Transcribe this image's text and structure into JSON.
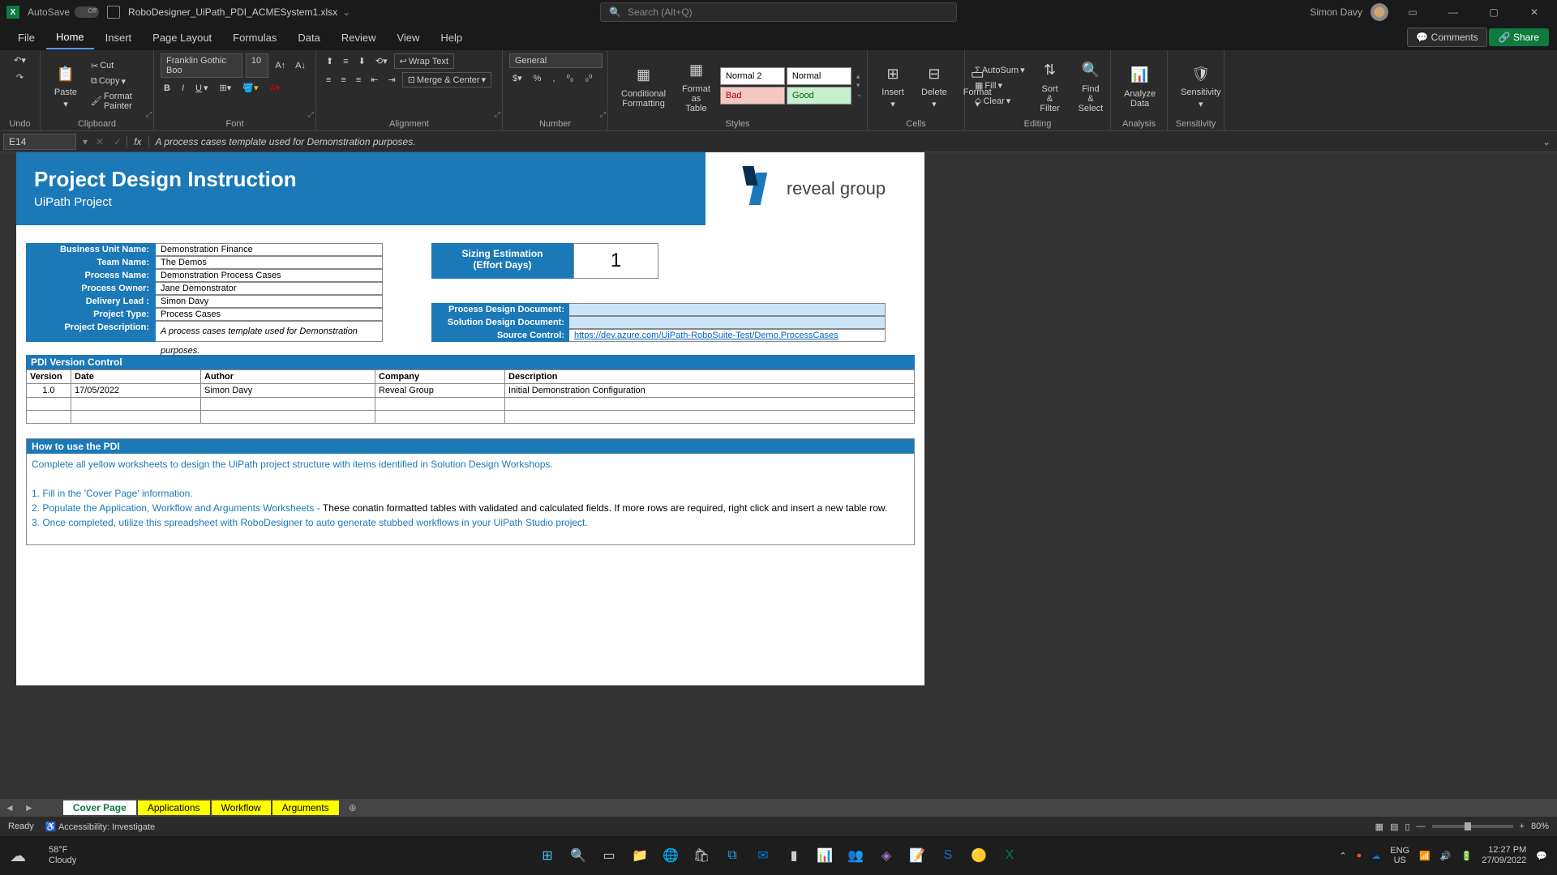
{
  "titlebar": {
    "autosave": "AutoSave",
    "filename": "RoboDesigner_UiPath_PDI_ACMESystem1.xlsx",
    "search_placeholder": "Search (Alt+Q)",
    "user": "Simon Davy"
  },
  "menu": {
    "file": "File",
    "home": "Home",
    "insert": "Insert",
    "page_layout": "Page Layout",
    "formulas": "Formulas",
    "data": "Data",
    "review": "Review",
    "view": "View",
    "help": "Help",
    "comments": "Comments",
    "share": "Share"
  },
  "ribbon": {
    "undo": "Undo",
    "paste": "Paste",
    "cut": "Cut",
    "copy": "Copy",
    "format_painter": "Format Painter",
    "clipboard": "Clipboard",
    "font_name": "Franklin Gothic Boo",
    "font_size": "10",
    "font": "Font",
    "wrap_text": "Wrap Text",
    "merge_center": "Merge & Center",
    "alignment": "Alignment",
    "number_format": "General",
    "number": "Number",
    "cond_fmt": "Conditional\nFormatting",
    "fmt_table": "Format as\nTable",
    "style_normal2": "Normal 2",
    "style_normal": "Normal",
    "style_bad": "Bad",
    "style_good": "Good",
    "styles": "Styles",
    "insert_btn": "Insert",
    "delete_btn": "Delete",
    "format_btn": "Format",
    "cells": "Cells",
    "autosum": "AutoSum",
    "fill": "Fill",
    "clear": "Clear",
    "sort_filter": "Sort &\nFilter",
    "find_select": "Find &\nSelect",
    "editing": "Editing",
    "analyze": "Analyze\nData",
    "analysis": "Analysis",
    "sensitivity": "Sensitivity",
    "sensitivity_g": "Sensitivity"
  },
  "fbar": {
    "cell": "E14",
    "formula": "A process cases template used for Demonstration purposes."
  },
  "doc": {
    "title": "Project Design Instruction",
    "subtitle": "UiPath Project",
    "logo_text": "reveal group",
    "labels": {
      "bu": "Business Unit Name:",
      "team": "Team Name:",
      "process": "Process Name:",
      "owner": "Process Owner:",
      "lead": "Delivery Lead :",
      "ptype": "Project Type:",
      "pdesc": "Project Description:"
    },
    "values": {
      "bu": "Demonstration Finance",
      "team": "The Demos",
      "process": "Demonstration Process Cases",
      "owner": "Jane Demonstrator",
      "lead": "Simon Davy",
      "ptype": "Process Cases",
      "pdesc": "A process cases template used for Demonstration purposes."
    },
    "size_label": "Sizing Estimation\n(Effort Days)",
    "size_value": "1",
    "doc_labels": {
      "pdd": "Process Design Document:",
      "sdd": "Solution Design Document:",
      "src": "Source Control:"
    },
    "doc_values": {
      "pdd": "",
      "sdd": "",
      "src": "https://dev.azure.com/UiPath-RoboSuite-Test/Demo.ProcessCases"
    },
    "vc_title": "PDI Version Control",
    "vc_headers": {
      "version": "Version",
      "date": "Date",
      "author": "Author",
      "company": "Company",
      "desc": "Description"
    },
    "vc_rows": [
      {
        "version": "1.0",
        "date": "17/05/2022",
        "author": "Simon Davy",
        "company": "Reveal Group",
        "desc": "Initial Demonstration Configuration"
      }
    ],
    "how_title": "How to use the PDI",
    "how_intro": "Complete all yellow worksheets to design the UiPath project structure with items identified in Solution Design Workshops.",
    "how_1": "1. Fill in the 'Cover Page' information.",
    "how_2a": "2. Populate the Application, Workflow and Arguments Worksheets - ",
    "how_2b": "These conatin formatted tables with validated and calculated fields. If more rows are required, right click and insert a new table row.",
    "how_3": "3. Once completed, utilize this spreadsheet with RoboDesigner to auto generate stubbed workflows in your UiPath Studio project."
  },
  "tabs": {
    "cover": "Cover Page",
    "applications": "Applications",
    "workflow": "Workflow",
    "arguments": "Arguments"
  },
  "status": {
    "ready": "Ready",
    "access": "Accessibility: Investigate",
    "zoom": "80%"
  },
  "taskbar": {
    "temp": "58°F",
    "cond": "Cloudy",
    "lang": "ENG",
    "region": "US",
    "time": "12:27 PM",
    "date": "27/09/2022"
  }
}
